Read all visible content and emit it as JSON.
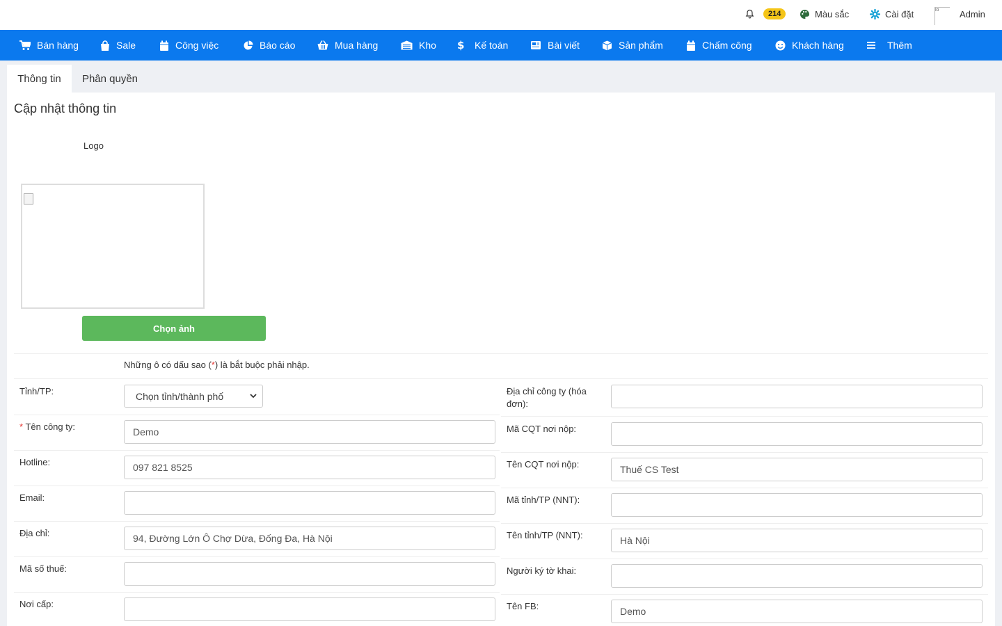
{
  "topbar": {
    "notifications": {
      "icon": "bell-icon",
      "count": "214"
    },
    "colors": {
      "icon": "palette-icon",
      "label": "Màu sắc"
    },
    "settings": {
      "icon": "gear-icon",
      "label": "Cài đặt"
    },
    "user": {
      "avatar_alt": "lo",
      "name": "Admin"
    }
  },
  "nav": {
    "items": [
      {
        "label": "Bán hàng",
        "icon": "cart-icon"
      },
      {
        "label": "Sale",
        "icon": "shopping-bag-icon"
      },
      {
        "label": "Công việc",
        "icon": "calendar-icon"
      },
      {
        "label": "Báo cáo",
        "icon": "pie-chart-icon"
      },
      {
        "label": "Mua hàng",
        "icon": "basket-icon"
      },
      {
        "label": "Kho",
        "icon": "warehouse-icon"
      },
      {
        "label": "Kế toán",
        "icon": "dollar-icon"
      },
      {
        "label": "Bài viết",
        "icon": "newspaper-icon"
      },
      {
        "label": "Sản phẩm",
        "icon": "box-icon"
      },
      {
        "label": "Chấm công",
        "icon": "calendar-icon"
      },
      {
        "label": "Khách hàng",
        "icon": "smile-icon"
      },
      {
        "label": "Thêm",
        "icon": "menu-icon"
      }
    ]
  },
  "tabs": [
    {
      "label": "Thông tin",
      "active": true
    },
    {
      "label": "Phân quyền",
      "active": false
    }
  ],
  "page": {
    "title": "Cập nhật thông tin",
    "logo_label": "Logo",
    "choose_image_button": "Chọn ảnh",
    "required_note_before": "Những ô có dấu sao (",
    "required_note_star": "*",
    "required_note_after": ") là bắt buộc phải nhập."
  },
  "form": {
    "left": [
      {
        "label": "Tỉnh/TP:",
        "required": false,
        "type": "select",
        "value": "Chọn tỉnh/thành phố"
      },
      {
        "label": "Tên công ty:",
        "required": true,
        "type": "input",
        "value": "Demo"
      },
      {
        "label": "Hotline:",
        "required": false,
        "type": "input",
        "value": "097 821 8525"
      },
      {
        "label": "Email:",
        "required": false,
        "type": "input",
        "value": ""
      },
      {
        "label": "Địa chỉ:",
        "required": false,
        "type": "input",
        "value": "94, Đường Lớn Ô Chợ Dừa, Đống Đa, Hà Nội"
      },
      {
        "label": "Mã số thuế:",
        "required": false,
        "type": "input",
        "value": ""
      },
      {
        "label": "Nơi cấp:",
        "required": false,
        "type": "input",
        "value": ""
      }
    ],
    "right": [
      {
        "label": "Địa chỉ công ty (hóa đơn):",
        "type": "input",
        "value": ""
      },
      {
        "label": "Mã CQT nơi nộp:",
        "type": "input",
        "value": ""
      },
      {
        "label": "Tên CQT nơi nộp:",
        "type": "input",
        "value": "Thuế CS Test"
      },
      {
        "label": "Mã tỉnh/TP (NNT):",
        "type": "input",
        "value": ""
      },
      {
        "label": "Tên tỉnh/TP (NNT):",
        "type": "input",
        "value": "Hà Nội"
      },
      {
        "label": "Người ký tờ khai:",
        "type": "input",
        "value": ""
      },
      {
        "label": "Tên FB:",
        "type": "input",
        "value": "Demo"
      }
    ]
  },
  "colors": {
    "nav_bg": "#0b79ee",
    "button_green": "#5cb85c",
    "badge_yellow": "#f5c518",
    "required_red": "#e53935"
  }
}
